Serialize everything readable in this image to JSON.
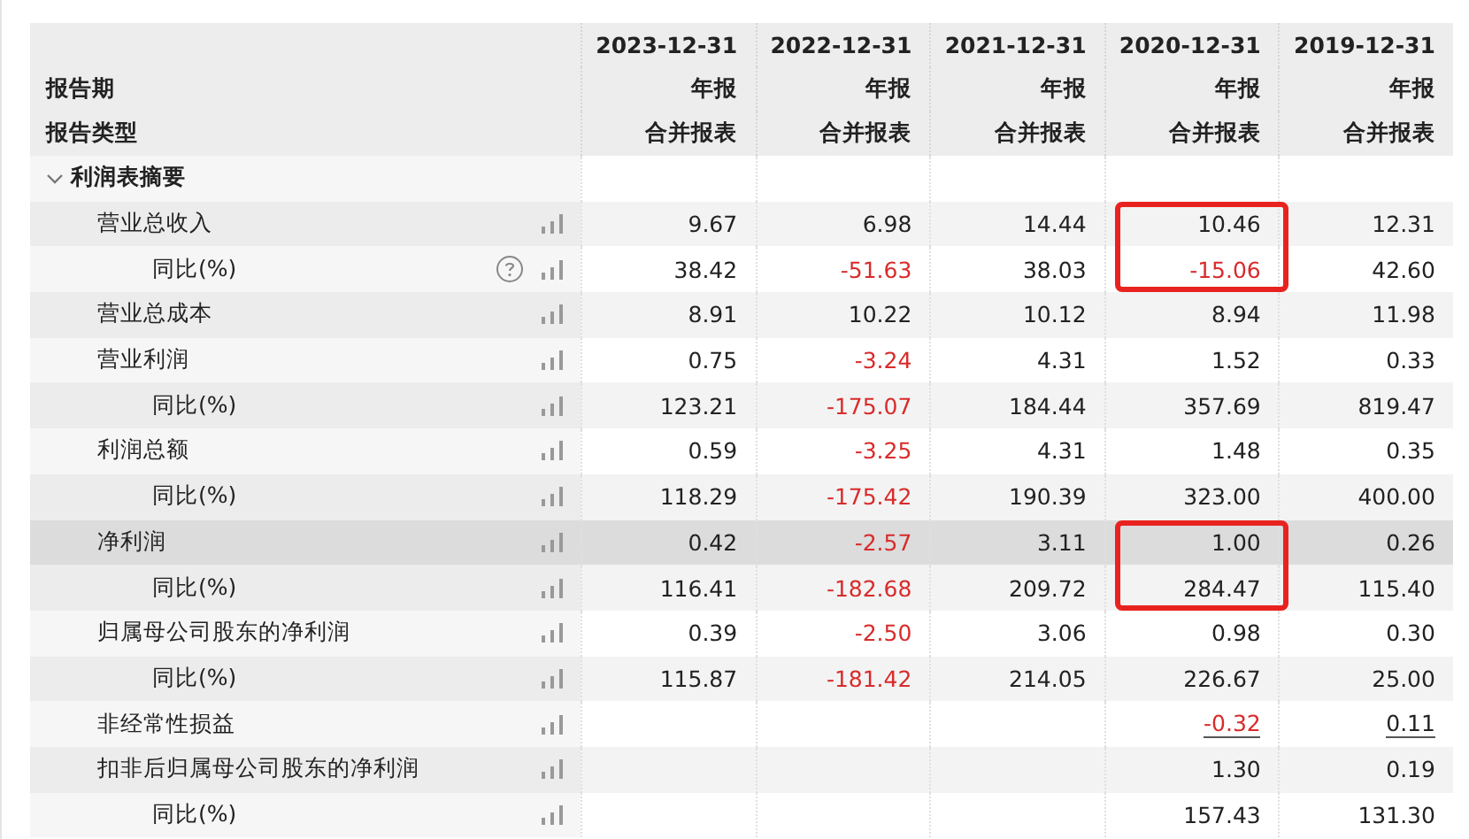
{
  "header": {
    "period_label": "报告期",
    "type_label": "报告类型",
    "columns": [
      {
        "date": "2023-12-31",
        "period": "年报",
        "type": "合并报表"
      },
      {
        "date": "2022-12-31",
        "period": "年报",
        "type": "合并报表"
      },
      {
        "date": "2021-12-31",
        "period": "年报",
        "type": "合并报表"
      },
      {
        "date": "2020-12-31",
        "period": "年报",
        "type": "合并报表"
      },
      {
        "date": "2019-12-31",
        "period": "年报",
        "type": "合并报表"
      }
    ]
  },
  "sections": [
    {
      "label": "利润表摘要",
      "expanded": true,
      "children": [
        {
          "label": "营业总收入",
          "selected": false,
          "help": false,
          "cells": [
            {
              "text": "9.67",
              "negative": false,
              "linked": false,
              "boxed": false
            },
            {
              "text": "6.98",
              "negative": false,
              "linked": false,
              "boxed": false
            },
            {
              "text": "14.44",
              "negative": false,
              "linked": false,
              "boxed": false
            },
            {
              "text": "10.46",
              "negative": false,
              "linked": false,
              "boxed": true
            },
            {
              "text": "12.31",
              "negative": false,
              "linked": false,
              "boxed": false
            }
          ],
          "children": [
            {
              "label": "同比(%)",
              "selected": false,
              "help": true,
              "cells": [
                {
                  "text": "38.42",
                  "negative": false,
                  "linked": false,
                  "boxed": false
                },
                {
                  "text": "-51.63",
                  "negative": true,
                  "linked": false,
                  "boxed": false
                },
                {
                  "text": "38.03",
                  "negative": false,
                  "linked": false,
                  "boxed": false
                },
                {
                  "text": "-15.06",
                  "negative": true,
                  "linked": false,
                  "boxed": true
                },
                {
                  "text": "42.60",
                  "negative": false,
                  "linked": false,
                  "boxed": false
                }
              ]
            }
          ]
        },
        {
          "label": "营业总成本",
          "selected": false,
          "help": false,
          "cells": [
            {
              "text": "8.91",
              "negative": false,
              "linked": false,
              "boxed": false
            },
            {
              "text": "10.22",
              "negative": false,
              "linked": false,
              "boxed": false
            },
            {
              "text": "10.12",
              "negative": false,
              "linked": false,
              "boxed": false
            },
            {
              "text": "8.94",
              "negative": false,
              "linked": false,
              "boxed": false
            },
            {
              "text": "11.98",
              "negative": false,
              "linked": false,
              "boxed": false
            }
          ]
        },
        {
          "label": "营业利润",
          "selected": false,
          "help": false,
          "cells": [
            {
              "text": "0.75",
              "negative": false,
              "linked": false,
              "boxed": false
            },
            {
              "text": "-3.24",
              "negative": true,
              "linked": false,
              "boxed": false
            },
            {
              "text": "4.31",
              "negative": false,
              "linked": false,
              "boxed": false
            },
            {
              "text": "1.52",
              "negative": false,
              "linked": false,
              "boxed": false
            },
            {
              "text": "0.33",
              "negative": false,
              "linked": false,
              "boxed": false
            }
          ],
          "children": [
            {
              "label": "同比(%)",
              "selected": false,
              "help": false,
              "cells": [
                {
                  "text": "123.21",
                  "negative": false,
                  "linked": false,
                  "boxed": false
                },
                {
                  "text": "-175.07",
                  "negative": true,
                  "linked": false,
                  "boxed": false
                },
                {
                  "text": "184.44",
                  "negative": false,
                  "linked": false,
                  "boxed": false
                },
                {
                  "text": "357.69",
                  "negative": false,
                  "linked": false,
                  "boxed": false
                },
                {
                  "text": "819.47",
                  "negative": false,
                  "linked": false,
                  "boxed": false
                }
              ]
            }
          ]
        },
        {
          "label": "利润总额",
          "selected": false,
          "help": false,
          "cells": [
            {
              "text": "0.59",
              "negative": false,
              "linked": false,
              "boxed": false
            },
            {
              "text": "-3.25",
              "negative": true,
              "linked": false,
              "boxed": false
            },
            {
              "text": "4.31",
              "negative": false,
              "linked": false,
              "boxed": false
            },
            {
              "text": "1.48",
              "negative": false,
              "linked": false,
              "boxed": false
            },
            {
              "text": "0.35",
              "negative": false,
              "linked": false,
              "boxed": false
            }
          ],
          "children": [
            {
              "label": "同比(%)",
              "selected": false,
              "help": false,
              "cells": [
                {
                  "text": "118.29",
                  "negative": false,
                  "linked": false,
                  "boxed": false
                },
                {
                  "text": "-175.42",
                  "negative": true,
                  "linked": false,
                  "boxed": false
                },
                {
                  "text": "190.39",
                  "negative": false,
                  "linked": false,
                  "boxed": false
                },
                {
                  "text": "323.00",
                  "negative": false,
                  "linked": false,
                  "boxed": false
                },
                {
                  "text": "400.00",
                  "negative": false,
                  "linked": false,
                  "boxed": false
                }
              ]
            }
          ]
        },
        {
          "label": "净利润",
          "selected": true,
          "help": false,
          "cells": [
            {
              "text": "0.42",
              "negative": false,
              "linked": false,
              "boxed": false
            },
            {
              "text": "-2.57",
              "negative": true,
              "linked": false,
              "boxed": false
            },
            {
              "text": "3.11",
              "negative": false,
              "linked": false,
              "boxed": false
            },
            {
              "text": "1.00",
              "negative": false,
              "linked": false,
              "boxed": true
            },
            {
              "text": "0.26",
              "negative": false,
              "linked": false,
              "boxed": false
            }
          ],
          "children": [
            {
              "label": "同比(%)",
              "selected": false,
              "help": false,
              "cells": [
                {
                  "text": "116.41",
                  "negative": false,
                  "linked": false,
                  "boxed": false
                },
                {
                  "text": "-182.68",
                  "negative": true,
                  "linked": false,
                  "boxed": false
                },
                {
                  "text": "209.72",
                  "negative": false,
                  "linked": false,
                  "boxed": false
                },
                {
                  "text": "284.47",
                  "negative": false,
                  "linked": false,
                  "boxed": true
                },
                {
                  "text": "115.40",
                  "negative": false,
                  "linked": false,
                  "boxed": false
                }
              ]
            }
          ]
        },
        {
          "label": "归属母公司股东的净利润",
          "selected": false,
          "help": false,
          "cells": [
            {
              "text": "0.39",
              "negative": false,
              "linked": false,
              "boxed": false
            },
            {
              "text": "-2.50",
              "negative": true,
              "linked": false,
              "boxed": false
            },
            {
              "text": "3.06",
              "negative": false,
              "linked": false,
              "boxed": false
            },
            {
              "text": "0.98",
              "negative": false,
              "linked": false,
              "boxed": false
            },
            {
              "text": "0.30",
              "negative": false,
              "linked": false,
              "boxed": false
            }
          ],
          "children": [
            {
              "label": "同比(%)",
              "selected": false,
              "help": false,
              "cells": [
                {
                  "text": "115.87",
                  "negative": false,
                  "linked": false,
                  "boxed": false
                },
                {
                  "text": "-181.42",
                  "negative": true,
                  "linked": false,
                  "boxed": false
                },
                {
                  "text": "214.05",
                  "negative": false,
                  "linked": false,
                  "boxed": false
                },
                {
                  "text": "226.67",
                  "negative": false,
                  "linked": false,
                  "boxed": false
                },
                {
                  "text": "25.00",
                  "negative": false,
                  "linked": false,
                  "boxed": false
                }
              ]
            }
          ]
        },
        {
          "label": "非经常性损益",
          "selected": false,
          "help": false,
          "cells": [
            null,
            null,
            null,
            {
              "text": "-0.32",
              "negative": true,
              "linked": true,
              "boxed": false
            },
            {
              "text": "0.11",
              "negative": false,
              "linked": true,
              "boxed": false
            }
          ]
        },
        {
          "label": "扣非后归属母公司股东的净利润",
          "selected": false,
          "help": false,
          "cells": [
            null,
            null,
            null,
            {
              "text": "1.30",
              "negative": false,
              "linked": false,
              "boxed": false
            },
            {
              "text": "0.19",
              "negative": false,
              "linked": false,
              "boxed": false
            }
          ],
          "children": [
            {
              "label": "同比(%)",
              "selected": false,
              "help": false,
              "cells": [
                null,
                null,
                null,
                {
                  "text": "157.43",
                  "negative": false,
                  "linked": false,
                  "boxed": false
                },
                {
                  "text": "131.30",
                  "negative": false,
                  "linked": false,
                  "boxed": false
                }
              ]
            }
          ]
        }
      ]
    }
  ]
}
